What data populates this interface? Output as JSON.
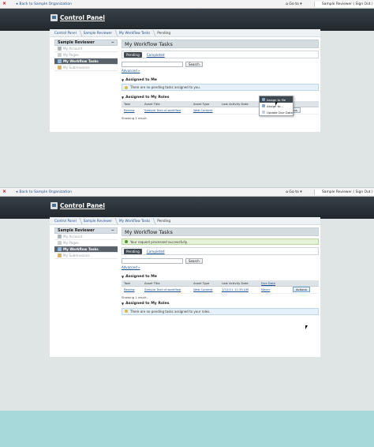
{
  "dockbar": {
    "back_label": "Back to Sample Organization",
    "goto_label": "Go to",
    "user_label": "Sample Reviewer ( Sign Out )"
  },
  "header": {
    "title": "Control Panel"
  },
  "breadcrumb": [
    "Control Panel",
    "Sample Reviewer",
    "My Workflow Tasks",
    "Pending"
  ],
  "sidebar": {
    "title": "Sample Reviewer",
    "collapse_symbol": "−",
    "items": [
      {
        "label": "My Account",
        "icon": "user-icon"
      },
      {
        "label": "My Pages",
        "icon": "pages-icon"
      },
      {
        "label": "My Workflow Tasks",
        "icon": "workflow-icon",
        "selected": true
      },
      {
        "label": "My Submissions",
        "icon": "submissions-icon"
      }
    ]
  },
  "portlet": {
    "title": "My Workflow Tasks",
    "tabs": [
      "Pending",
      "Completed"
    ],
    "search_button": "Search",
    "advanced_link": "Advanced »",
    "assigned_to_me": "Assigned to Me",
    "assigned_to_roles": "Assigned to My Roles",
    "no_tasks_me": "There are no pending tasks assigned to you.",
    "no_tasks_roles": "There are no pending tasks assigned to your roles.",
    "success_msg": "Your request processed successfully.",
    "showing": "Showing 1 result."
  },
  "table": {
    "columns1": [
      "Task",
      "Asset Title",
      "Asset Type",
      "Last Activity Date",
      "Due Date",
      ""
    ],
    "row1": [
      "Review",
      "Sample Text of workflow",
      "Web Content",
      "",
      "Never",
      "Actions"
    ],
    "columns2": [
      "Task",
      "Asset Title",
      "Asset Type",
      "Last Activity Date",
      "Due Date",
      ""
    ],
    "row2": [
      "Review",
      "Sample Text of workflow",
      "Web Content",
      "1/12/11 11:35 AM",
      "Never",
      "Actions"
    ]
  },
  "menu": {
    "items": [
      "Assign to Me",
      "Assign to...",
      "Update Due Date"
    ]
  },
  "colors": {
    "header": "#20282d",
    "selected_nav": "#59626a",
    "link": "#1f4e8c",
    "bottom_band": "#a7d9db"
  }
}
